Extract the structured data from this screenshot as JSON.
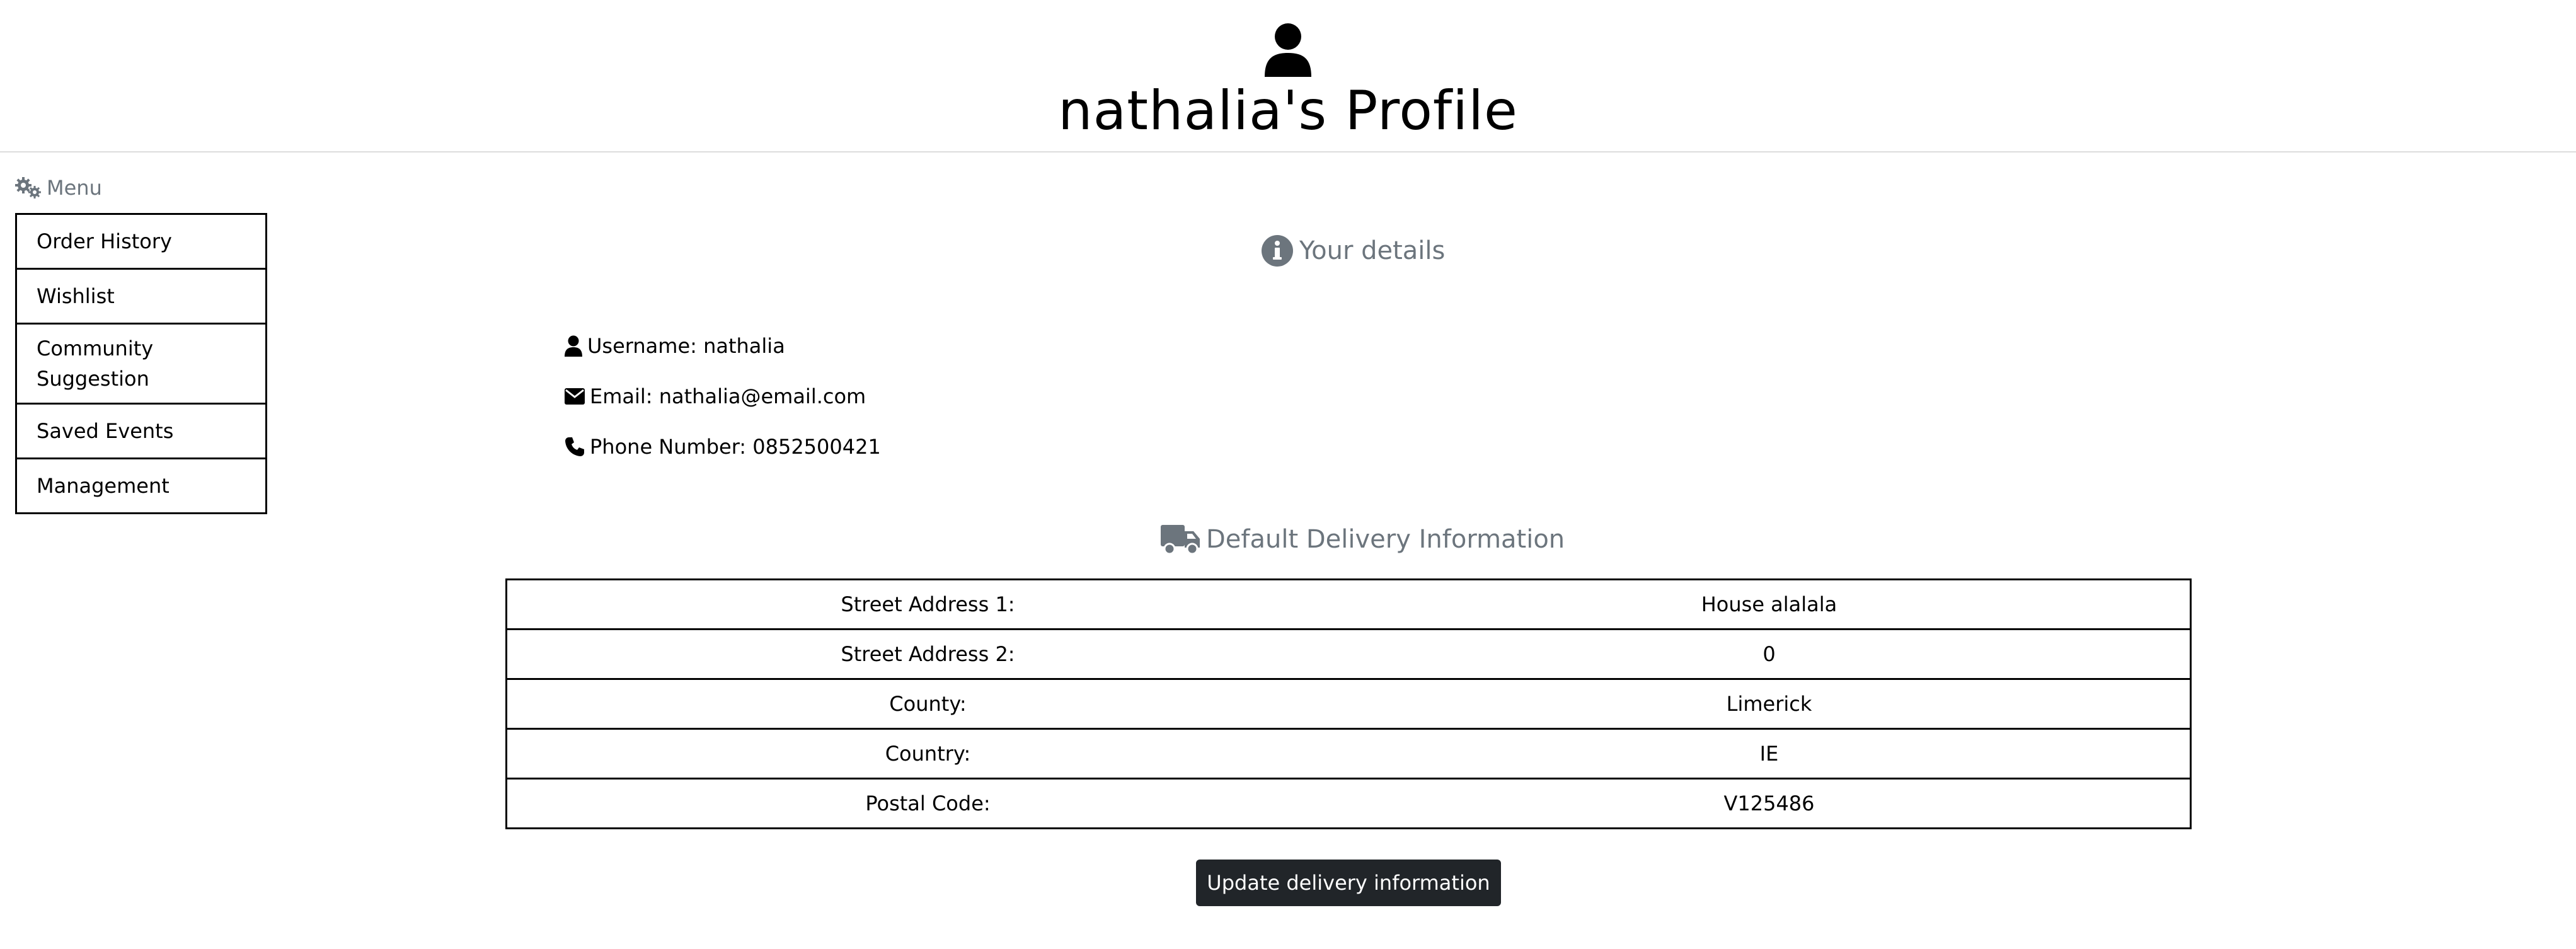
{
  "header": {
    "avatar_icon": "user-icon",
    "title": "nathalia's Profile"
  },
  "sidebar": {
    "menu_icon": "gears-icon",
    "menu_label": "Menu",
    "items": [
      {
        "label": "Order History"
      },
      {
        "label": "Wishlist"
      },
      {
        "label": "Community Suggestion"
      },
      {
        "label": "Saved Events"
      },
      {
        "label": "Management"
      }
    ]
  },
  "details": {
    "icon": "info-circle-icon",
    "heading": "Your details",
    "username": {
      "icon": "user-icon",
      "text": "Username: nathalia"
    },
    "email": {
      "icon": "envelope-icon",
      "text": "Email: nathalia@email.com"
    },
    "phone": {
      "icon": "phone-icon",
      "text": "Phone Number: 0852500421"
    }
  },
  "delivery": {
    "icon": "truck-icon",
    "heading": "Default Delivery Information",
    "rows": [
      {
        "label": "Street Address 1:",
        "value": "House alalala"
      },
      {
        "label": "Street Address 2:",
        "value": "0"
      },
      {
        "label": "County:",
        "value": "Limerick"
      },
      {
        "label": "Country:",
        "value": "IE"
      },
      {
        "label": "Postal Code:",
        "value": "V125486"
      }
    ],
    "update_button": "Update delivery information"
  },
  "colors": {
    "muted": "#6c757d",
    "button_bg": "#212529",
    "border": "#000000"
  }
}
